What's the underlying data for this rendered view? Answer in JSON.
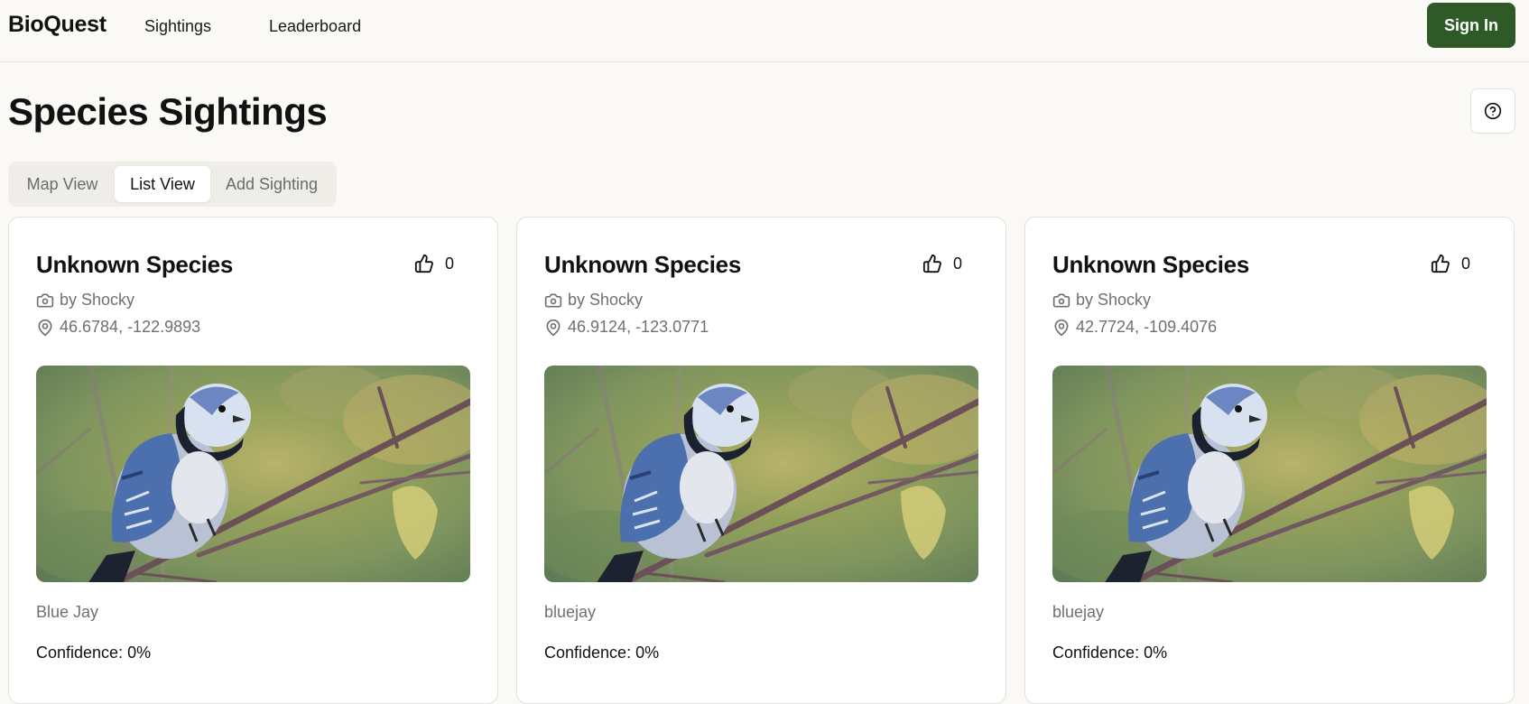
{
  "nav": {
    "brand": "BioQuest",
    "links": [
      "Sightings",
      "Leaderboard"
    ],
    "signin_label": "Sign In"
  },
  "page": {
    "title": "Species Sightings"
  },
  "tabs": [
    {
      "label": "Map View",
      "active": false
    },
    {
      "label": "List View",
      "active": true
    },
    {
      "label": "Add Sighting",
      "active": false
    }
  ],
  "cards": [
    {
      "title": "Unknown Species",
      "likes": "0",
      "author": "by Shocky",
      "coords": "46.6784, -122.9893",
      "species": "Blue Jay",
      "confidence": "Confidence: 0%"
    },
    {
      "title": "Unknown Species",
      "likes": "0",
      "author": "by Shocky",
      "coords": "46.9124, -123.0771",
      "species": "bluejay",
      "confidence": "Confidence: 0%"
    },
    {
      "title": "Unknown Species",
      "likes": "0",
      "author": "by Shocky",
      "coords": "42.7724, -109.4076",
      "species": "bluejay",
      "confidence": "Confidence: 0%"
    }
  ],
  "icons": {
    "help": "help-circle-icon",
    "like": "thumbs-up-icon",
    "author": "camera-icon",
    "location": "map-pin-icon"
  },
  "colors": {
    "accent": "#2d5a27",
    "background": "#faf9f6",
    "muted_text": "#707070"
  }
}
